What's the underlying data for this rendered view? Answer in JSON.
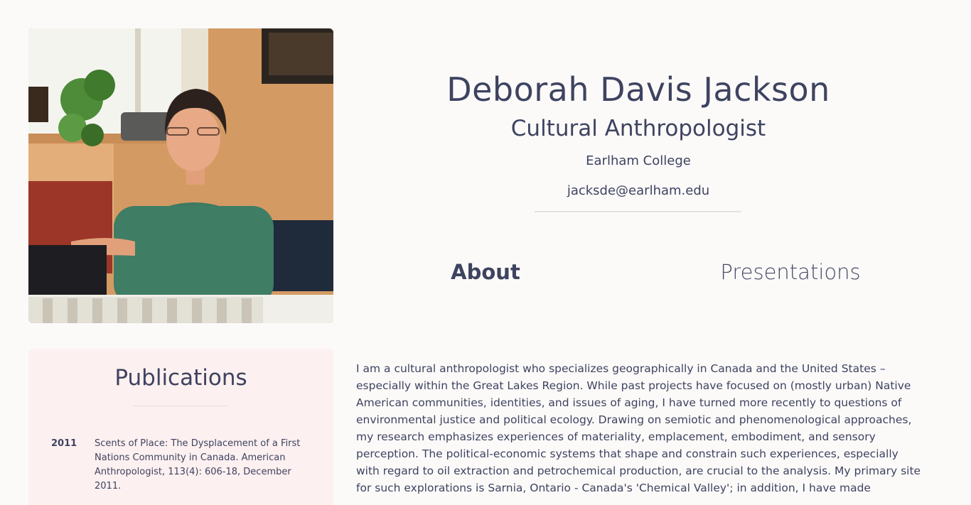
{
  "profile": {
    "photo_icon": "portrait-photo",
    "name": "Deborah Davis Jackson",
    "title": "Cultural Anthropologist",
    "institution": "Earlham College",
    "email": "jacksde@earlham.edu"
  },
  "tabs": [
    {
      "label": "About",
      "active": true
    },
    {
      "label": "Presentations",
      "active": false
    }
  ],
  "publications": {
    "heading": "Publications",
    "items": [
      {
        "year": "2011",
        "text": "Scents of Place: The Dysplacement of a First Nations Community in Canada. American Anthropologist, 113(4): 606-18, December 2011."
      }
    ]
  },
  "about": {
    "text": "I am a cultural anthropologist who specializes geographically in Canada and the United States – especially within the Great Lakes Region. While past projects have focused on (mostly urban) Native American communities, identities, and issues of aging, I have turned more recently to questions of environmental justice and political ecology. Drawing on semiotic and phenomenological approaches, my research emphasizes experiences of materiality, emplacement, embodiment, and sensory perception. The political-economic systems that shape and constrain such experiences, especially with regard to oil extraction and petrochemical production, are crucial to the analysis. My primary site for such explorations is Sarnia, Ontario - Canada's 'Chemical Valley'; in addition, I have made"
  },
  "colors": {
    "text": "#3e4360",
    "background": "#fcfaf9",
    "publications_panel": "#fdf0f0"
  }
}
